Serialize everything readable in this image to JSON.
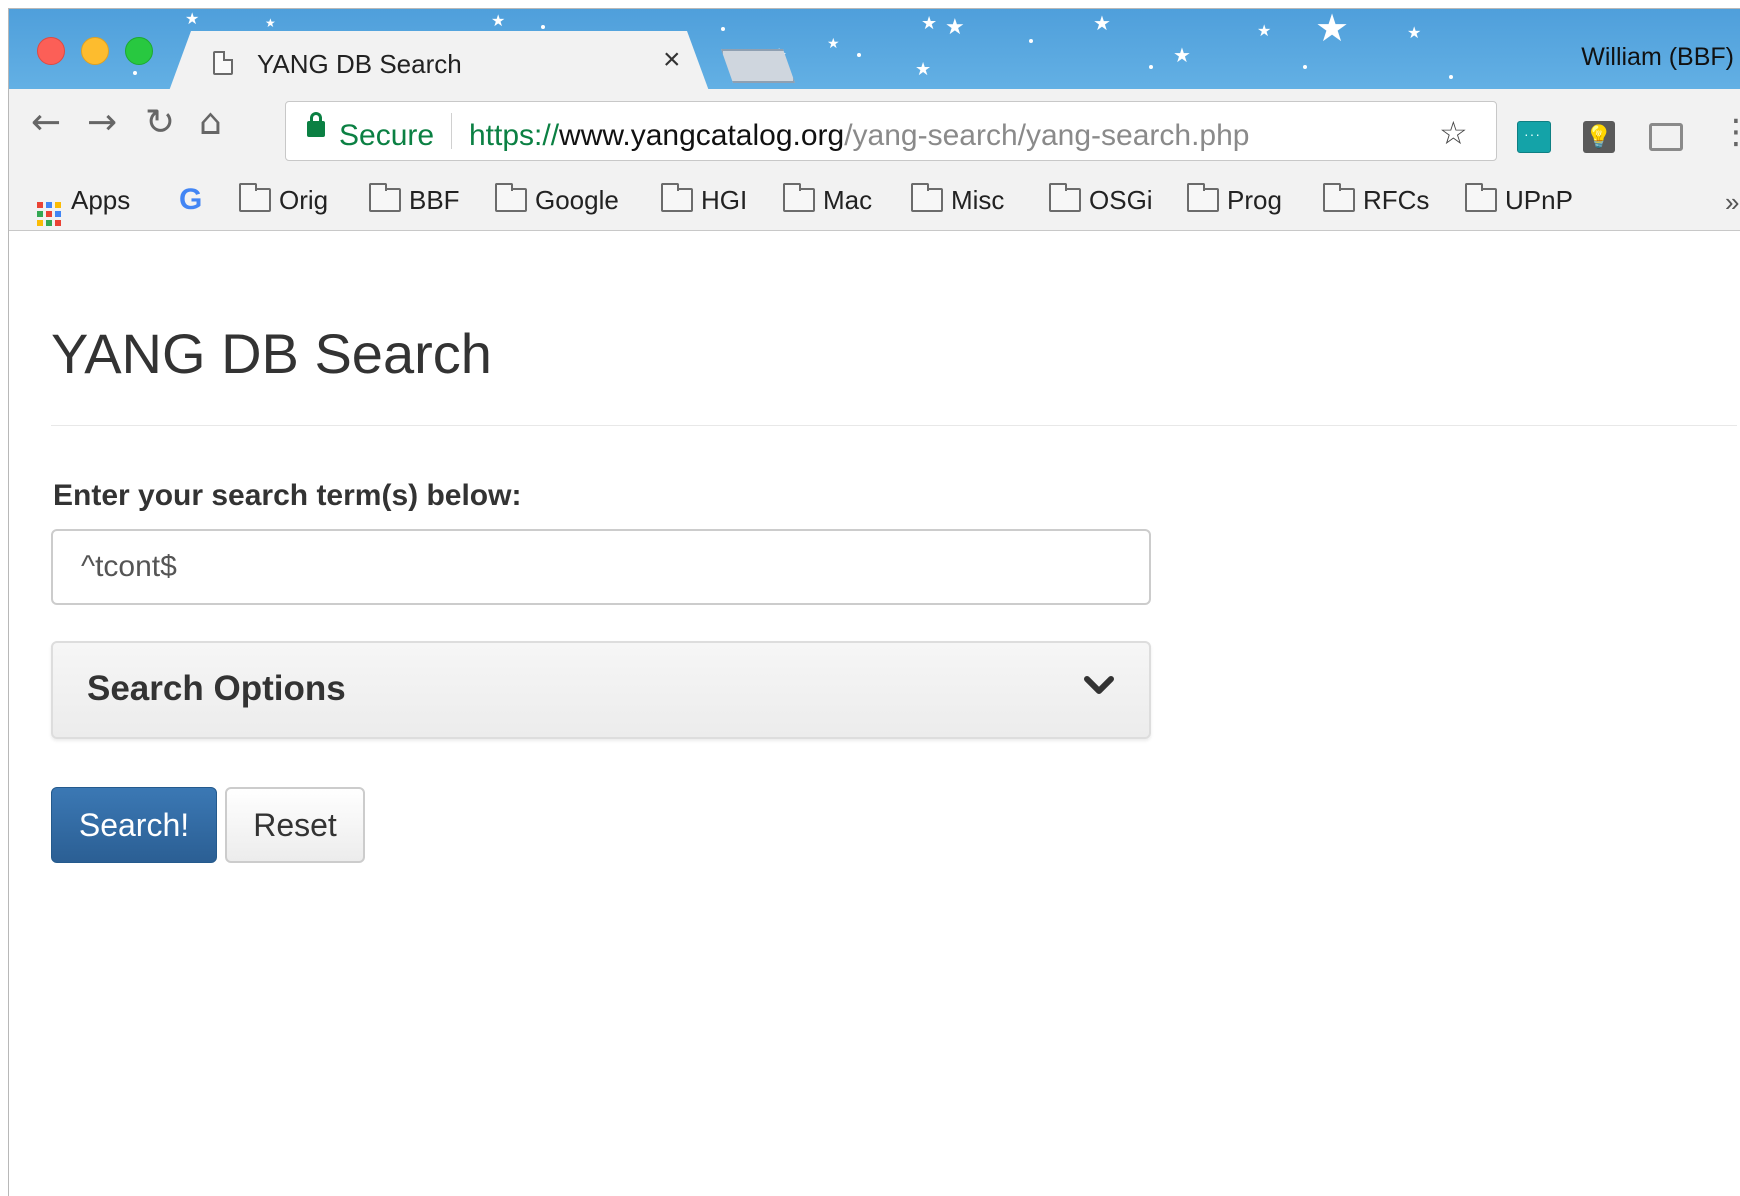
{
  "window": {
    "tab_title": "YANG DB Search",
    "tab_close": "×",
    "profile_name": "William (BBF)"
  },
  "toolbar": {
    "back": "←",
    "forward": "→",
    "reload": "↻",
    "home": "⌂",
    "secure_label": "Secure",
    "url_scheme": "https://",
    "url_host": "www.yangcatalog.org",
    "url_path": "/yang-search/yang-search.php",
    "bookmark_star": "☆",
    "menu": "⋮"
  },
  "bookmarks": {
    "apps_label": "Apps",
    "google_glyph": "G",
    "folders": [
      "Orig",
      "BBF",
      "Google",
      "HGI",
      "Mac",
      "Misc",
      "OSGi",
      "Prog",
      "RFCs",
      "UPnP"
    ],
    "more": "»"
  },
  "page": {
    "title": "YANG DB Search",
    "search_label": "Enter your search term(s) below:",
    "search_value": "^tcont$",
    "options_title": "Search Options",
    "search_button": "Search!",
    "reset_button": "Reset"
  },
  "colors": {
    "titlebar": "#5aa8e0",
    "secure_green": "#0b8043",
    "primary_button": "#2f6aa3"
  },
  "icons": {
    "tab_icon": "page-icon",
    "lock": "lock-icon",
    "options_toggle": "chevron-down-icon",
    "extension_1": "extension-icon",
    "extension_2": "lightbulb-icon",
    "cast": "cast-icon"
  }
}
